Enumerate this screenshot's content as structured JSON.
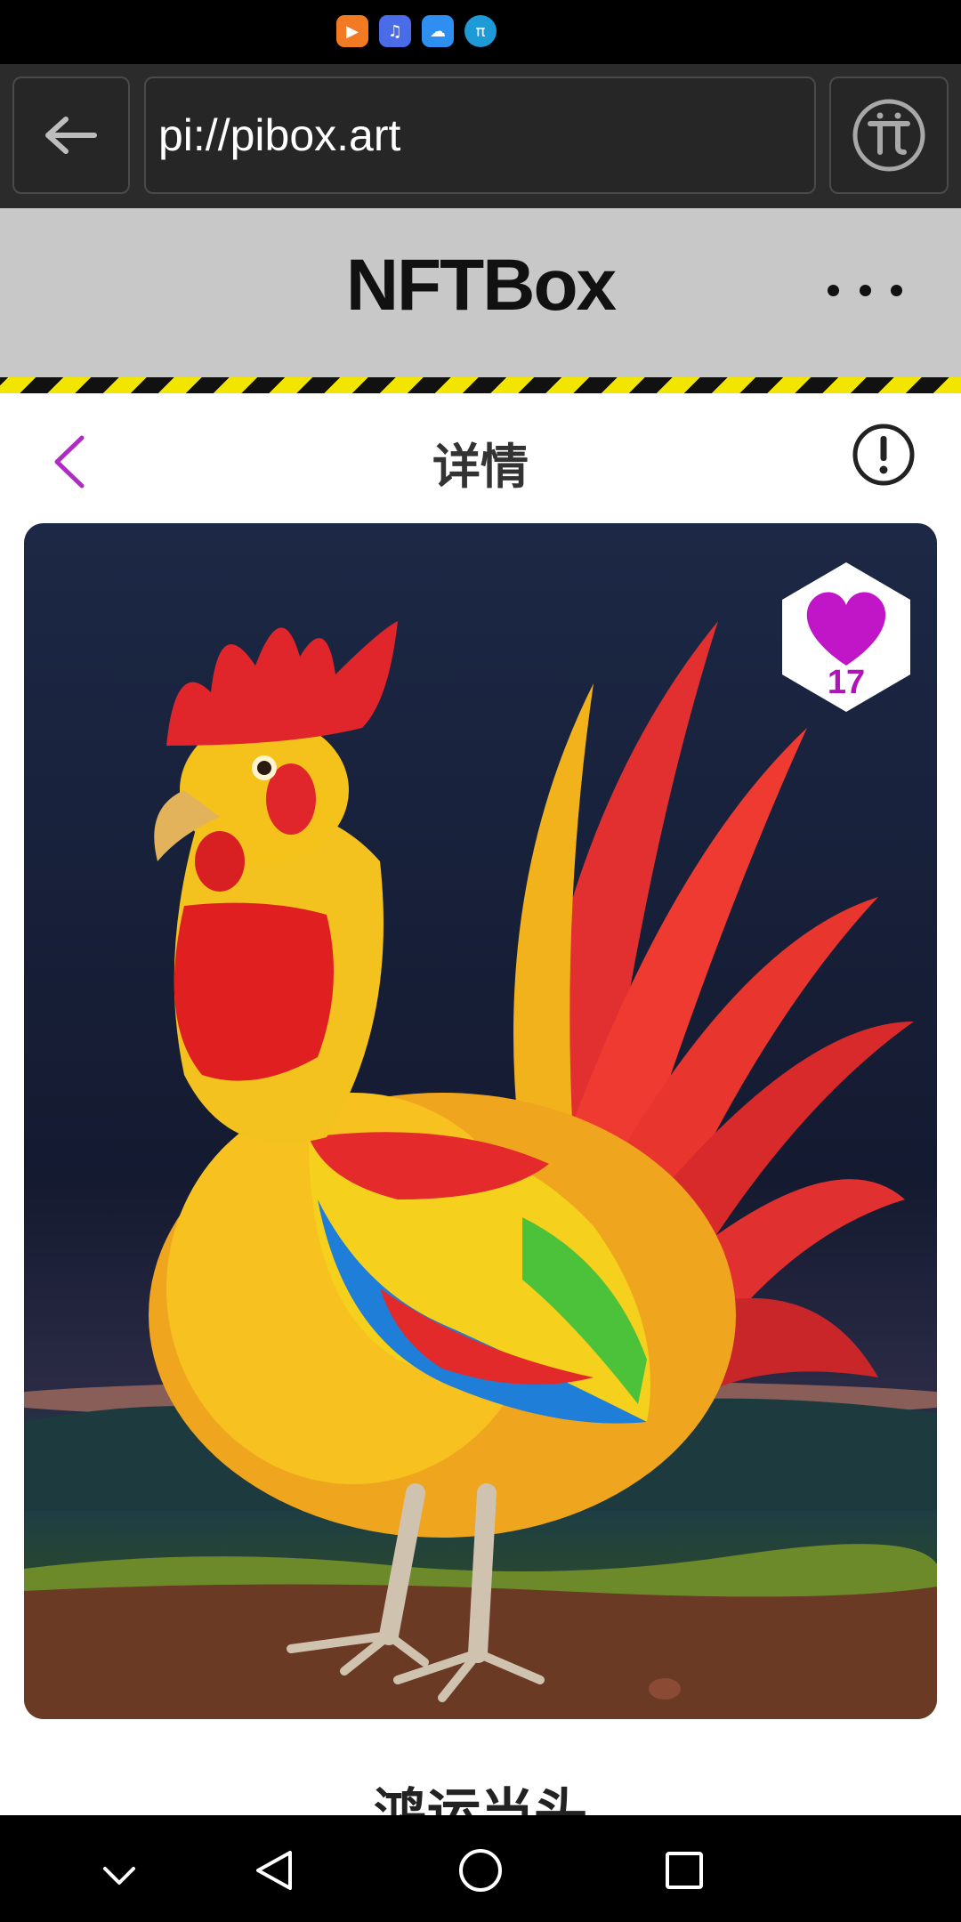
{
  "status_bar": {
    "icons": [
      "app-icon-orange",
      "music-icon",
      "cloud-icon",
      "pi-network-icon"
    ]
  },
  "browser": {
    "url": "pi://pibox.art",
    "back_icon": "arrow-left-icon",
    "pi_icon": "pi-logo-icon"
  },
  "header": {
    "title": "NFTBox",
    "more_icon": "more-dots-icon"
  },
  "page": {
    "title": "详情",
    "back_icon": "chevron-left-icon",
    "info_icon": "info-icon"
  },
  "nft": {
    "likes": "17",
    "title": "鸿运当头",
    "accent_color": "#b014b8"
  },
  "system_nav": {
    "icons": [
      "hide-keyboard-icon",
      "back-triangle-icon",
      "home-circle-icon",
      "recents-square-icon"
    ]
  }
}
